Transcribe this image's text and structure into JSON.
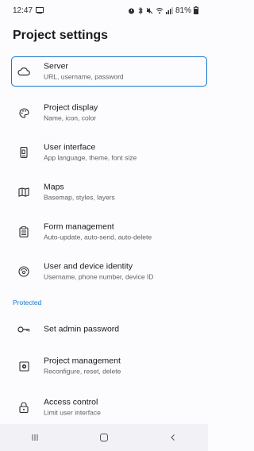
{
  "status_bar": {
    "time": "12:47",
    "battery": "81%"
  },
  "page": {
    "title": "Project settings"
  },
  "items": [
    {
      "title": "Server",
      "subtitle": "URL, username, password",
      "icon": "cloud-icon"
    },
    {
      "title": "Project display",
      "subtitle": "Name, icon, color",
      "icon": "palette-icon"
    },
    {
      "title": "User interface",
      "subtitle": "App language, theme, font size",
      "icon": "phone-icon"
    },
    {
      "title": "Maps",
      "subtitle": "Basemap, styles, layers",
      "icon": "map-icon"
    },
    {
      "title": "Form management",
      "subtitle": "Auto-update, auto-send, auto-delete",
      "icon": "clipboard-icon"
    },
    {
      "title": "User and device identity",
      "subtitle": "Username, phone number, device ID",
      "icon": "identity-icon"
    }
  ],
  "protected_section": {
    "header": "Protected",
    "items": [
      {
        "title": "Set admin password",
        "icon": "key-icon"
      },
      {
        "title": "Project management",
        "subtitle": "Reconfigure, reset, delete",
        "icon": "settings-box-icon"
      },
      {
        "title": "Access control",
        "subtitle": "Limit user interface",
        "icon": "lock-icon"
      }
    ]
  },
  "colors": {
    "accent": "#1577d1",
    "text": "#1b1b1f",
    "secondary_text": "#606166",
    "background": "#fcfbfd"
  }
}
